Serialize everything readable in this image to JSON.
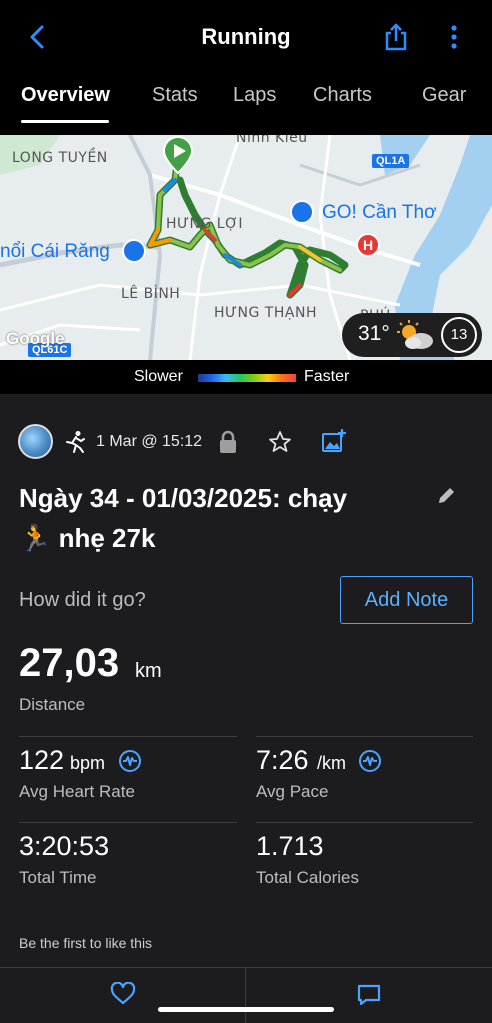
{
  "header": {
    "title": "Running",
    "back_icon": "chevron-left-icon",
    "share_icon": "share-icon",
    "more_icon": "more-vertical-icon"
  },
  "tabs": [
    {
      "label": "Overview",
      "active": true
    },
    {
      "label": "Stats",
      "active": false
    },
    {
      "label": "Laps",
      "active": false
    },
    {
      "label": "Charts",
      "active": false
    },
    {
      "label": "Gear",
      "active": false
    }
  ],
  "map": {
    "labels": {
      "long_tuyen": "LONG TUYỀN",
      "hung_loi": "HƯNG LỢI",
      "le_binh": "LÊ BÌNH",
      "hung_thanh": "HƯNG THẠNH",
      "phu": "PHÚ",
      "top_partial": "Ninh Kiều",
      "go_can_tho": "GO! Cần Thơ",
      "cai_rang": "nổi Cái Răng",
      "ql1a": "QL1A",
      "ql61c": "QL61C",
      "google": "Google"
    },
    "weather": {
      "temperature": "31°",
      "icon": "partly-cloudy-sun-icon",
      "wind": "13"
    }
  },
  "legend": {
    "slower": "Slower",
    "faster": "Faster"
  },
  "activity": {
    "date": "1 Mar @ 15:12",
    "title_line1": "Ngày 34 - 01/03/2025: chạy",
    "title_line2": "🏃 nhẹ 27k",
    "how_prompt": "How did it go?",
    "add_note": "Add Note"
  },
  "stats": {
    "distance": {
      "value": "27,03",
      "unit": "km",
      "label": "Distance"
    },
    "heart_rate": {
      "value": "122",
      "unit": "bpm",
      "label": "Avg Heart Rate"
    },
    "pace": {
      "value": "7:26",
      "unit": "/km",
      "label": "Avg Pace"
    },
    "total_time": {
      "value": "3:20:53",
      "label": "Total Time"
    },
    "calories": {
      "value": "1.713",
      "label": "Total Calories"
    }
  },
  "social": {
    "like_text": "Be the first to like this"
  },
  "colors": {
    "accent_blue": "#4aa3ff",
    "background": "#1c1c1e",
    "header": "#000000"
  }
}
